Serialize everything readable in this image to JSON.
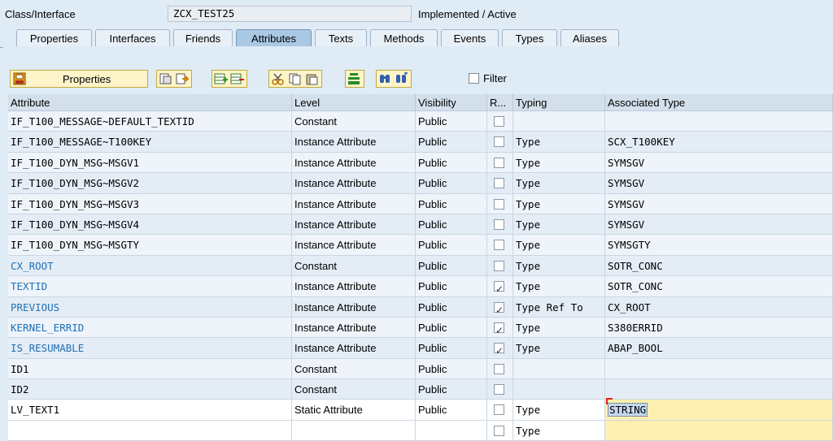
{
  "header": {
    "class_label": "Class/Interface",
    "class_name": "ZCX_TEST25",
    "status": "Implemented / Active"
  },
  "tabs": [
    {
      "label": "Properties"
    },
    {
      "label": "Interfaces"
    },
    {
      "label": "Friends"
    },
    {
      "label": "Attributes"
    },
    {
      "label": "Texts"
    },
    {
      "label": "Methods"
    },
    {
      "label": "Events"
    },
    {
      "label": "Types"
    },
    {
      "label": "Aliases"
    }
  ],
  "active_tab": "Attributes",
  "toolbar": {
    "properties_label": "Properties",
    "filter_label": "Filter",
    "icons": [
      "properties-icon",
      "copy-icon",
      "paste-icon",
      "insert-row-icon",
      "delete-row-icon",
      "cut-icon",
      "copy2-icon",
      "paste2-icon",
      "detail-icon",
      "find-icon",
      "find-next-icon"
    ]
  },
  "table": {
    "columns": [
      "Attribute",
      "Level",
      "Visibility",
      "R...",
      "Typing",
      "Associated Type"
    ],
    "rows": [
      {
        "attribute": "IF_T100_MESSAGE~DEFAULT_TEXTID",
        "level": "Constant",
        "visibility": "Public",
        "readonly": false,
        "typing": "",
        "assoc": ""
      },
      {
        "attribute": "IF_T100_MESSAGE~T100KEY",
        "level": "Instance Attribute",
        "visibility": "Public",
        "readonly": false,
        "typing": "Type",
        "assoc": "SCX_T100KEY"
      },
      {
        "attribute": "IF_T100_DYN_MSG~MSGV1",
        "level": "Instance Attribute",
        "visibility": "Public",
        "readonly": false,
        "typing": "Type",
        "assoc": "SYMSGV"
      },
      {
        "attribute": "IF_T100_DYN_MSG~MSGV2",
        "level": "Instance Attribute",
        "visibility": "Public",
        "readonly": false,
        "typing": "Type",
        "assoc": "SYMSGV"
      },
      {
        "attribute": "IF_T100_DYN_MSG~MSGV3",
        "level": "Instance Attribute",
        "visibility": "Public",
        "readonly": false,
        "typing": "Type",
        "assoc": "SYMSGV"
      },
      {
        "attribute": "IF_T100_DYN_MSG~MSGV4",
        "level": "Instance Attribute",
        "visibility": "Public",
        "readonly": false,
        "typing": "Type",
        "assoc": "SYMSGV"
      },
      {
        "attribute": "IF_T100_DYN_MSG~MSGTY",
        "level": "Instance Attribute",
        "visibility": "Public",
        "readonly": false,
        "typing": "Type",
        "assoc": "SYMSGTY"
      },
      {
        "attribute": "CX_ROOT",
        "level": "Constant",
        "visibility": "Public",
        "readonly": false,
        "typing": "Type",
        "assoc": "SOTR_CONC",
        "inherited": true
      },
      {
        "attribute": "TEXTID",
        "level": "Instance Attribute",
        "visibility": "Public",
        "readonly": true,
        "typing": "Type",
        "assoc": "SOTR_CONC",
        "inherited": true
      },
      {
        "attribute": "PREVIOUS",
        "level": "Instance Attribute",
        "visibility": "Public",
        "readonly": true,
        "typing": "Type Ref To",
        "assoc": "CX_ROOT",
        "inherited": true
      },
      {
        "attribute": "KERNEL_ERRID",
        "level": "Instance Attribute",
        "visibility": "Public",
        "readonly": true,
        "typing": "Type",
        "assoc": "S380ERRID",
        "inherited": true
      },
      {
        "attribute": "IS_RESUMABLE",
        "level": "Instance Attribute",
        "visibility": "Public",
        "readonly": true,
        "typing": "Type",
        "assoc": "ABAP_BOOL",
        "inherited": true
      },
      {
        "attribute": "ID1",
        "level": "Constant",
        "visibility": "Public",
        "readonly": false,
        "typing": "",
        "assoc": ""
      },
      {
        "attribute": "ID2",
        "level": "Constant",
        "visibility": "Public",
        "readonly": false,
        "typing": "",
        "assoc": ""
      },
      {
        "attribute": "LV_TEXT1",
        "level": "Static Attribute",
        "visibility": "Public",
        "readonly": false,
        "typing": "Type",
        "assoc": "STRING",
        "editing": true
      },
      {
        "attribute": "",
        "level": "",
        "visibility": "",
        "readonly": false,
        "typing": "Type",
        "assoc": "",
        "editing": true
      }
    ]
  },
  "colors": {
    "background": "#dfebf5",
    "inherited_text": "#1f6fb5",
    "toolbar_button": "#fdf4c9",
    "active_tab": "#a9c8e3",
    "edit_cell": "#fdf0b0"
  }
}
